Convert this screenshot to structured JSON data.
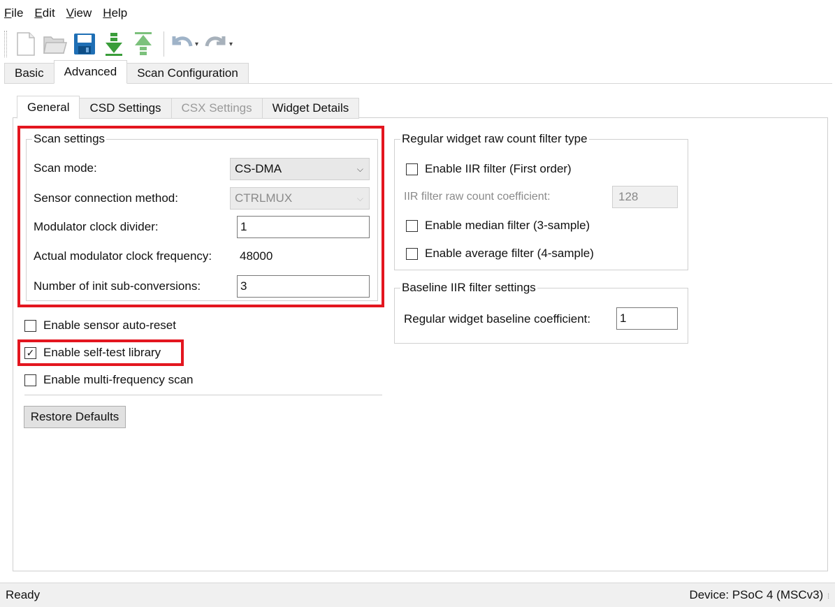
{
  "menu": {
    "items": [
      {
        "accel": "F",
        "rest": "ile"
      },
      {
        "accel": "E",
        "rest": "dit"
      },
      {
        "accel": "V",
        "rest": "iew"
      },
      {
        "accel": "H",
        "rest": "elp"
      }
    ]
  },
  "toolbar": {
    "icons": [
      "new-file-icon",
      "open-folder-icon",
      "save-icon",
      "import-icon",
      "export-icon",
      "undo-icon",
      "redo-icon"
    ]
  },
  "top_tabs": [
    "Basic",
    "Advanced",
    "Scan Configuration"
  ],
  "sub_tabs": [
    "General",
    "CSD Settings",
    "CSX Settings",
    "Widget Details"
  ],
  "scan_settings": {
    "title": "Scan settings",
    "scan_mode_label": "Scan mode:",
    "scan_mode_value": "CS-DMA",
    "sensor_conn_label": "Sensor connection method:",
    "sensor_conn_value": "CTRLMUX",
    "mod_clk_div_label": "Modulator clock divider:",
    "mod_clk_div_value": "1",
    "actual_freq_label": "Actual modulator clock frequency:",
    "actual_freq_value": "48000",
    "init_subconv_label": "Number of init sub-conversions:",
    "init_subconv_value": "3"
  },
  "options": {
    "auto_reset": "Enable sensor auto-reset",
    "self_test": "Enable self-test library",
    "multi_freq": "Enable multi-frequency scan"
  },
  "restore_defaults": "Restore Defaults",
  "raw_filter": {
    "title": "Regular widget raw count filter type",
    "iir": "Enable IIR filter (First order)",
    "iir_coef_label": "IIR filter raw count coefficient:",
    "iir_coef_value": "128",
    "median": "Enable median filter (3-sample)",
    "average": "Enable average filter (4-sample)"
  },
  "baseline": {
    "title": "Baseline IIR filter settings",
    "coef_label": "Regular widget baseline coefficient:",
    "coef_value": "1"
  },
  "status": {
    "left": "Ready",
    "right": "Device: PSoC 4 (MSCv3)"
  },
  "checkmark": "✓",
  "chevron": "⌵",
  "dropdown_arrow": "▾",
  "grip": "⁞",
  "colors": {
    "highlight": "#e3161f",
    "save_blue": "#1f6fb5",
    "arrow_green": "#3a9d3a"
  }
}
